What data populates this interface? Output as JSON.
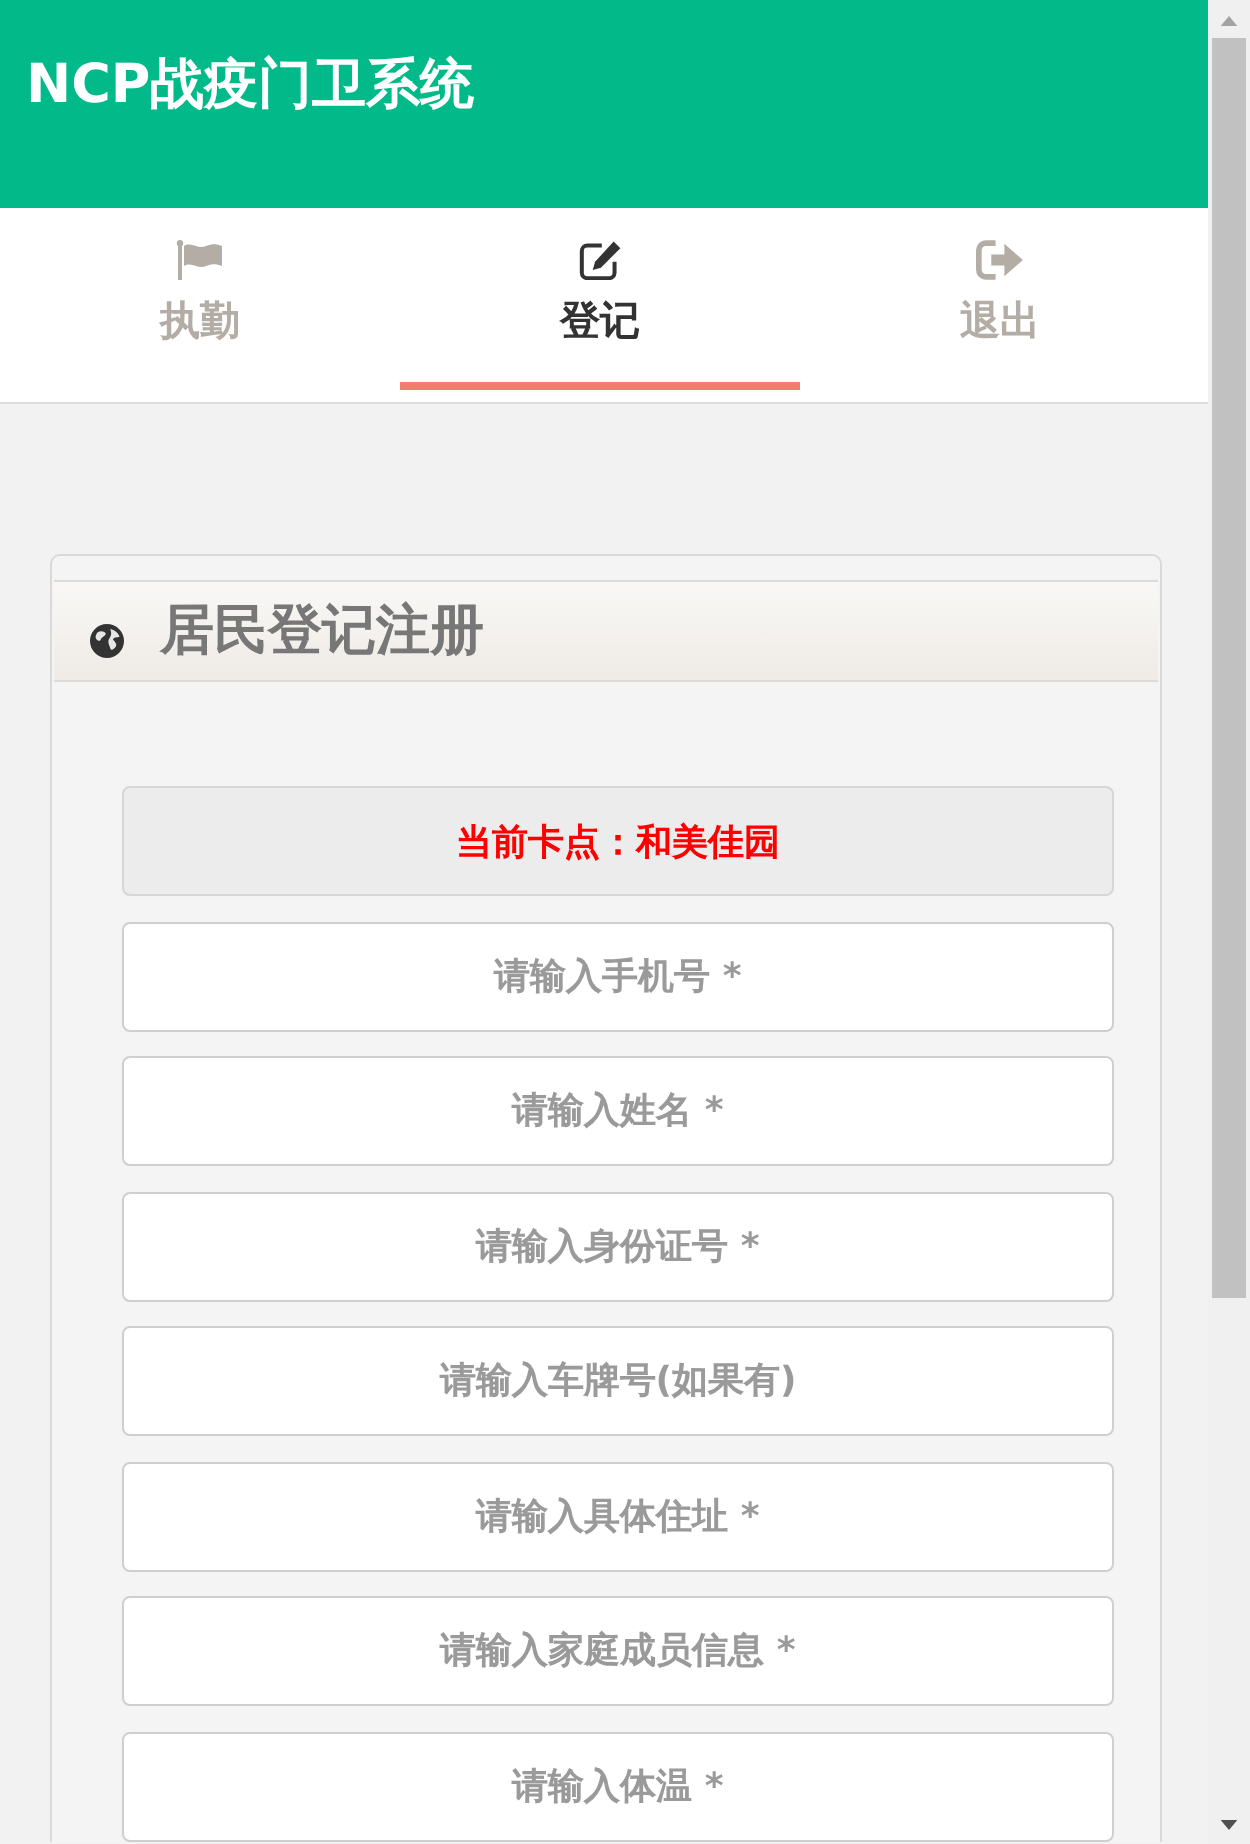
{
  "header": {
    "title": "NCP战疫门卫系统"
  },
  "tabs": [
    {
      "label": "执勤",
      "selected": false
    },
    {
      "label": "登记",
      "selected": true
    },
    {
      "label": "退出",
      "selected": false
    }
  ],
  "form": {
    "title": "居民登记注册",
    "checkpoint": {
      "text": "当前卡点：和美佳园",
      "disabled": true
    },
    "fields": [
      {
        "placeholder": "请输入手机号 *"
      },
      {
        "placeholder": "请输入姓名 *"
      },
      {
        "placeholder": "请输入身份证号 *"
      },
      {
        "placeholder": "请输入车牌号(如果有)"
      },
      {
        "placeholder": "请输入具体住址 *"
      },
      {
        "placeholder": "请输入家庭成员信息 *"
      },
      {
        "placeholder": "请输入体温 *"
      }
    ]
  }
}
